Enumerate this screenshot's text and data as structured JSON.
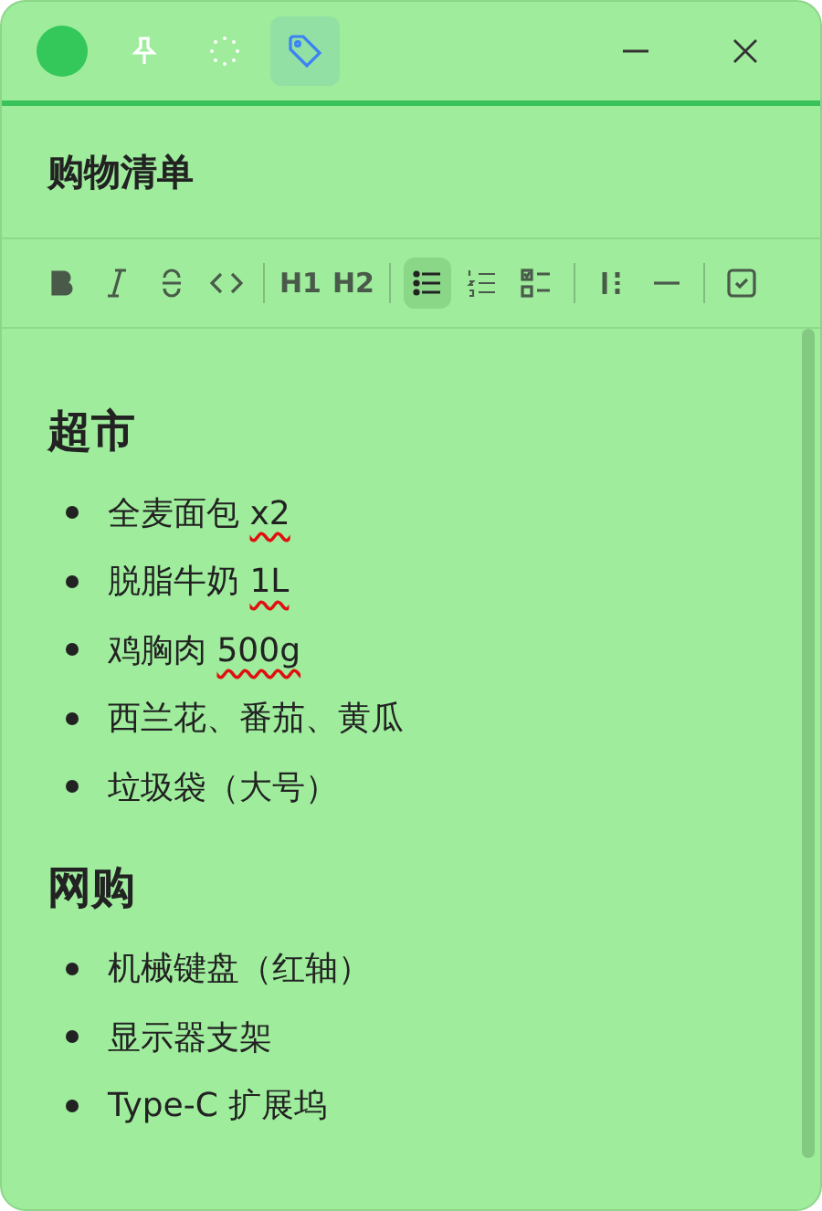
{
  "titlebar": {
    "color": "#34c759",
    "tools": [
      {
        "kind": "pin",
        "selected": false
      },
      {
        "kind": "dots",
        "selected": false
      },
      {
        "kind": "tag",
        "selected": true
      }
    ]
  },
  "title": "购物清单",
  "toolbar": [
    {
      "kind": "bold",
      "selected": false
    },
    {
      "kind": "italic",
      "selected": false
    },
    {
      "kind": "strike",
      "selected": false
    },
    {
      "kind": "code",
      "selected": false
    },
    {
      "kind": "sep"
    },
    {
      "kind": "text",
      "label": "H1",
      "selected": false
    },
    {
      "kind": "text",
      "label": "H2",
      "selected": false
    },
    {
      "kind": "sep"
    },
    {
      "kind": "bullet",
      "selected": true
    },
    {
      "kind": "ordered",
      "selected": false
    },
    {
      "kind": "task",
      "selected": false
    },
    {
      "kind": "sep"
    },
    {
      "kind": "columns",
      "selected": false
    },
    {
      "kind": "rule",
      "selected": false
    },
    {
      "kind": "sep"
    },
    {
      "kind": "check",
      "selected": false
    }
  ],
  "sections": [
    {
      "heading": "超市",
      "items": [
        {
          "text": "全麦面包",
          "flagged": "x2"
        },
        {
          "text": "脱脂牛奶",
          "flagged": "1L"
        },
        {
          "text": "鸡胸肉",
          "flagged": "500g"
        },
        {
          "text": "西兰花、番茄、黄瓜"
        },
        {
          "text": "垃圾袋（大号）"
        }
      ]
    },
    {
      "heading": "网购",
      "items": [
        {
          "text": "机械键盘（红轴）"
        },
        {
          "text": "显示器支架"
        },
        {
          "text": "Type-C 扩展坞"
        }
      ]
    }
  ]
}
